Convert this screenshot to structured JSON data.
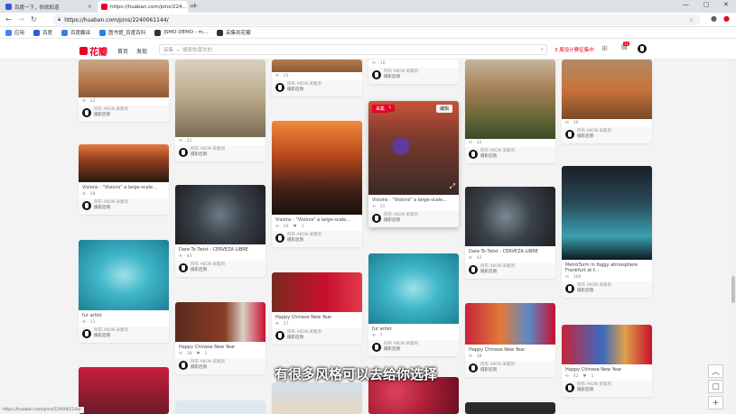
{
  "browser": {
    "tabs": [
      {
        "label": "百度一下，你就知道",
        "active": false
      },
      {
        "label": "https://huaban.com/pins/224...",
        "active": true
      }
    ],
    "url": "https://huaban.com/pins/2240061144/",
    "bookmarks": [
      "应用",
      "百度",
      "百度翻译",
      "图书馆_百度百科",
      "JSMO DEMO - m...",
      "采集到花瓣"
    ],
    "status_url": "https://huaban.com/pins/2240061144/"
  },
  "site": {
    "logo": "花瓣",
    "nav": [
      "首页",
      "发现"
    ],
    "search_scope": "采集",
    "search_placeholder": "搜索你喜欢的",
    "promo": "3 周设计赛征集中",
    "notify_count": "11"
  },
  "owner": {
    "name": "阿布",
    "suffix": "AKON 采集到",
    "board": "摄影后期"
  },
  "columns": [
    [
      {
        "caption": "",
        "repins": "22",
        "likes": ""
      },
      {
        "caption": "Visions : \"Visions\" a large-scale...",
        "repins": "28",
        "likes": ""
      },
      {
        "caption": "fur artist",
        "repins": "11",
        "likes": ""
      },
      {
        "caption": "",
        "repins": "",
        "likes": ""
      }
    ],
    [
      {
        "caption": "",
        "repins": "21",
        "likes": ""
      },
      {
        "caption": "Dare To Twist - CERVEZA LIBRE",
        "repins": "43",
        "likes": ""
      },
      {
        "caption": "Happy Chinese New Year",
        "repins": "38",
        "likes": "1"
      },
      {
        "caption": "",
        "repins": "",
        "likes": ""
      }
    ],
    [
      {
        "caption": "",
        "repins": "25",
        "likes": ""
      },
      {
        "caption": "Visions : \"Visions\" a large-scale...",
        "repins": "24",
        "likes": "1"
      },
      {
        "caption": "Happy Chinese New Year",
        "repins": "27",
        "likes": ""
      },
      {
        "caption": "",
        "repins": "",
        "likes": ""
      }
    ],
    [
      {
        "caption": "",
        "repins": "16",
        "likes": ""
      },
      {
        "caption": "Visions : \"Visions\" a large-scale...",
        "repins": "31",
        "likes": ""
      },
      {
        "caption": "fur artist",
        "repins": "7",
        "likes": ""
      },
      {
        "caption": "",
        "repins": "",
        "likes": ""
      }
    ],
    [
      {
        "caption": "",
        "repins": "12",
        "likes": ""
      },
      {
        "caption": "Dare To Twist - CERVEZA LIBRE",
        "repins": "42",
        "likes": ""
      },
      {
        "caption": "Happy Chinese New Year",
        "repins": "38",
        "likes": ""
      }
    ],
    [
      {
        "caption": "",
        "repins": "19",
        "likes": ""
      },
      {
        "caption": "MetroTurm in foggy atmosphere Frankfurt at t...",
        "repins": "100",
        "likes": ""
      },
      {
        "caption": "Happy Chinese New Year",
        "repins": "42",
        "likes": "1"
      }
    ]
  ],
  "hover_card": {
    "collect": "采集",
    "edit": "编辑"
  },
  "video_subtitle": "有很多风格可以去给你选择",
  "colors": {
    "brand": "#e60023"
  }
}
